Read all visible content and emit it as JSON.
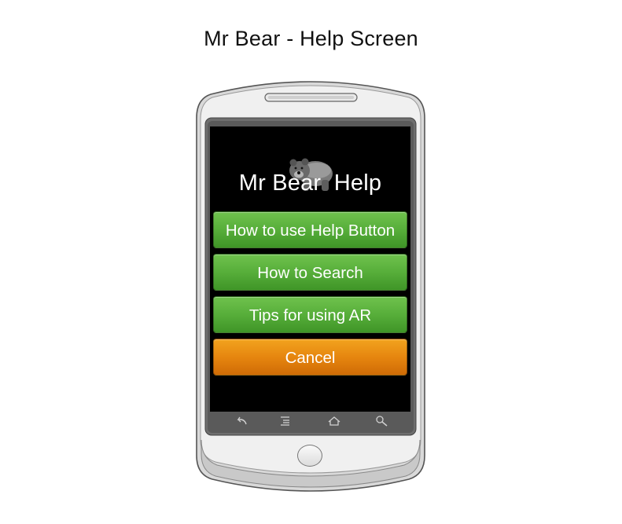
{
  "page": {
    "title": "Mr Bear - Help Screen"
  },
  "app": {
    "title": "Mr Bear  Help",
    "logo_icon": "bear-icon"
  },
  "menu": {
    "items": [
      {
        "label": "How to use Help Button",
        "style": "green"
      },
      {
        "label": "How to Search",
        "style": "green"
      },
      {
        "label": "Tips for using AR",
        "style": "green"
      },
      {
        "label": "Cancel",
        "style": "orange"
      }
    ]
  },
  "nav_bar": {
    "icons": [
      "back-icon",
      "menu-icon",
      "home-icon",
      "search-icon"
    ]
  },
  "colors": {
    "green_button": "#57ae3a",
    "orange_button": "#e6860f",
    "screen_background": "#000000",
    "phone_body": "#e6e6e6"
  }
}
